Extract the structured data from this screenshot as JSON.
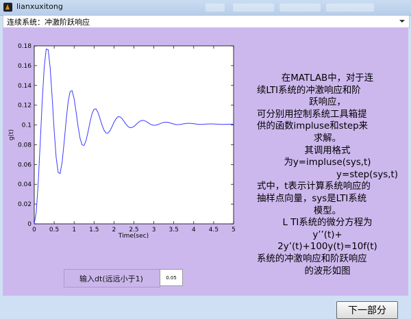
{
  "window": {
    "title": "lianxuxitong"
  },
  "panel": {
    "label": "连续系统：冲激阶跃响应"
  },
  "chart_data": {
    "type": "line",
    "xlabel": "Time(sec)",
    "ylabel": "g(t)",
    "xlim": [
      0,
      5
    ],
    "ylim": [
      0,
      0.18
    ],
    "xticks": [
      "0",
      "0.5",
      "1",
      "1.5",
      "2",
      "2.5",
      "3",
      "3.5",
      "4",
      "4.5",
      "5"
    ],
    "yticks": [
      "0",
      "0.02",
      "0.04",
      "0.06",
      "0.08",
      "0.1",
      "0.12",
      "0.14",
      "0.16",
      "0.18"
    ],
    "grid": false,
    "line_color": "#3a3aff",
    "series": [
      {
        "x": [
          0,
          0.05,
          0.1,
          0.15,
          0.2,
          0.25,
          0.3,
          0.35,
          0.4,
          0.45,
          0.5,
          0.55,
          0.6,
          0.65,
          0.7,
          0.75,
          0.8,
          0.85,
          0.9,
          0.95,
          1.0,
          1.05,
          1.1,
          1.15,
          1.2,
          1.25,
          1.3,
          1.35,
          1.4,
          1.45,
          1.5,
          1.55,
          1.6,
          1.65,
          1.7,
          1.75,
          1.8,
          1.85,
          1.9,
          1.95,
          2.0,
          2.05,
          2.1,
          2.15,
          2.2,
          2.25,
          2.3,
          2.35,
          2.4,
          2.45,
          2.5,
          2.55,
          2.6,
          2.65,
          2.7,
          2.75,
          2.8,
          2.85,
          2.9,
          2.95,
          3.0,
          3.05,
          3.1,
          3.15,
          3.2,
          3.25,
          3.3,
          3.35,
          3.4,
          3.45,
          3.5,
          3.55,
          3.6,
          3.65,
          3.7,
          3.75,
          3.8,
          3.85,
          3.9,
          3.95,
          4.0,
          4.05,
          4.1,
          4.15,
          4.2,
          4.25,
          4.3,
          4.35,
          4.4,
          4.45,
          4.5,
          4.55,
          4.6,
          4.65,
          4.7,
          4.75,
          4.8,
          4.85,
          4.9,
          4.95,
          5.0
        ],
        "values": [
          0.0,
          0.0118,
          0.0417,
          0.0822,
          0.1242,
          0.1583,
          0.1768,
          0.176,
          0.1575,
          0.1273,
          0.0942,
          0.067,
          0.052,
          0.051,
          0.0627,
          0.0825,
          0.1048,
          0.1234,
          0.1339,
          0.1346,
          0.1266,
          0.1131,
          0.0983,
          0.0864,
          0.0798,
          0.0793,
          0.0843,
          0.0932,
          0.1032,
          0.1115,
          0.116,
          0.1162,
          0.1125,
          0.1064,
          0.0999,
          0.0947,
          0.0919,
          0.0918,
          0.0942,
          0.0982,
          0.1027,
          0.1063,
          0.1083,
          0.1082,
          0.1065,
          0.1037,
          0.1008,
          0.0985,
          0.0973,
          0.0974,
          0.0985,
          0.1003,
          0.1023,
          0.1038,
          0.1046,
          0.1045,
          0.1037,
          0.1024,
          0.1011,
          0.1001,
          0.0997,
          0.0998,
          0.1004,
          0.1012,
          0.102,
          0.1026,
          0.1028,
          0.1026,
          0.1021,
          0.1015,
          0.1009,
          0.1005,
          0.1004,
          0.1005,
          0.1008,
          0.1012,
          0.1015,
          0.1017,
          0.1017,
          0.1015,
          0.1013,
          0.101,
          0.1007,
          0.1006,
          0.1006,
          0.1007,
          0.1009,
          0.101,
          0.1011,
          0.1011,
          0.101,
          0.1009,
          0.1008,
          0.1007,
          0.1006,
          0.1006,
          0.1007,
          0.1007,
          0.1008,
          0.1008,
          0.1008
        ]
      }
    ]
  },
  "controls": {
    "dt_label": "输入dt(远远小于1)",
    "dt_value": "0.05",
    "next_label": "下一部分"
  },
  "description": {
    "lines": [
      "在MATLAB中，对于连",
      "续LTI系统的冲激响应和阶",
      "跃响应，",
      "可分别用控制系统工具箱提",
      "供的函数impluse和step来",
      "求解。",
      "其调用格式",
      "为y=impluse(sys,t)",
      "y=step(sys,t)",
      "式中，t表示计算系统响应的",
      "抽样点向量，sys是LTI系统",
      "模型。",
      "L TI系统的微分方程为",
      "y’’(t)+",
      "2y’(t)+100y(t)=10f(t)",
      "系统的冲激响应和阶跃响应",
      "的波形如图"
    ]
  }
}
